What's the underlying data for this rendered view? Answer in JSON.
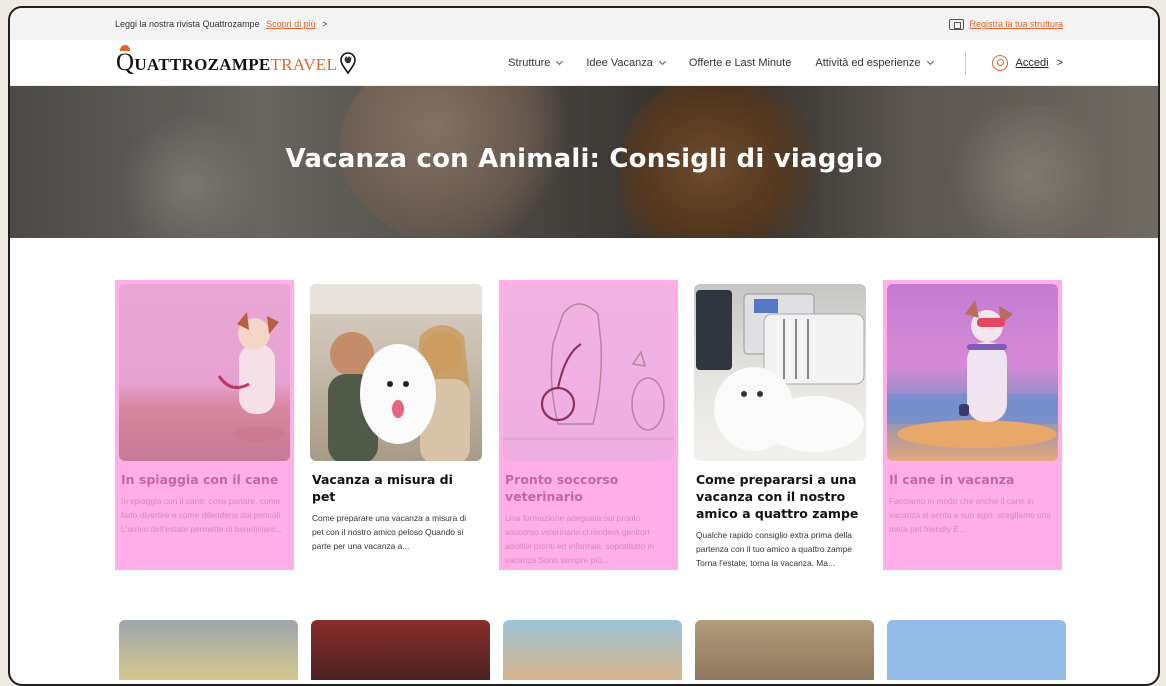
{
  "topbar": {
    "promo_text": "Leggi la nostra rivista Quattrozampe",
    "promo_link": "Scopri di più",
    "promo_arrow": ">",
    "register_link": "Registra la tua struttura"
  },
  "header": {
    "logo_q": "Q",
    "logo_a": "UATTROZAMPE",
    "logo_b": "TRAVEL",
    "menu": [
      {
        "label": "Strutture"
      },
      {
        "label": "Idee Vacanza"
      },
      {
        "label": "Offerte e Last Minute"
      },
      {
        "label": "Attività ed esperienze"
      }
    ],
    "login_label": "Accedi",
    "login_arrow": ">"
  },
  "hero": {
    "title": "Vacanza con Animali: Consigli di viaggio"
  },
  "colors": {
    "accent": "#e0632a",
    "highlight_pink": "#ffaee7",
    "highlight_title": "#c3689f"
  },
  "cards": [
    {
      "title": "In spiaggia con il cane",
      "excerpt": "In spiaggia con il cane: cosa portare, come farlo divertire e come difendersi dai pericoli L'arrivo dell'estate permette di beneficiare..."
    },
    {
      "title": "Vacanza a misura di pet",
      "excerpt": "Come preparare una vacanza a misura di pet con il nostro amico peloso Quando si parte per una vacanza a..."
    },
    {
      "title": "Pronto soccorso veterinario",
      "excerpt": "Una formazione adeguata sul pronto soccorso veterinario ci renderà genitori adottivi pronti ed informati, soprattutto in vacanza Sono sempre più..."
    },
    {
      "title": "Come prepararsi a una vacanza con il nostro amico a quattro zampe",
      "excerpt": "Qualche rapido consiglio extra prima della partenza con il tuo amico a quattro zampe Torna l'estate, torna la vacanza. Ma..."
    },
    {
      "title": "Il cane in vacanza",
      "excerpt": "Facciamo in modo che anche il cane in vacanza si senta a suo agio: scegliamo una meta pet friendly É..."
    }
  ]
}
